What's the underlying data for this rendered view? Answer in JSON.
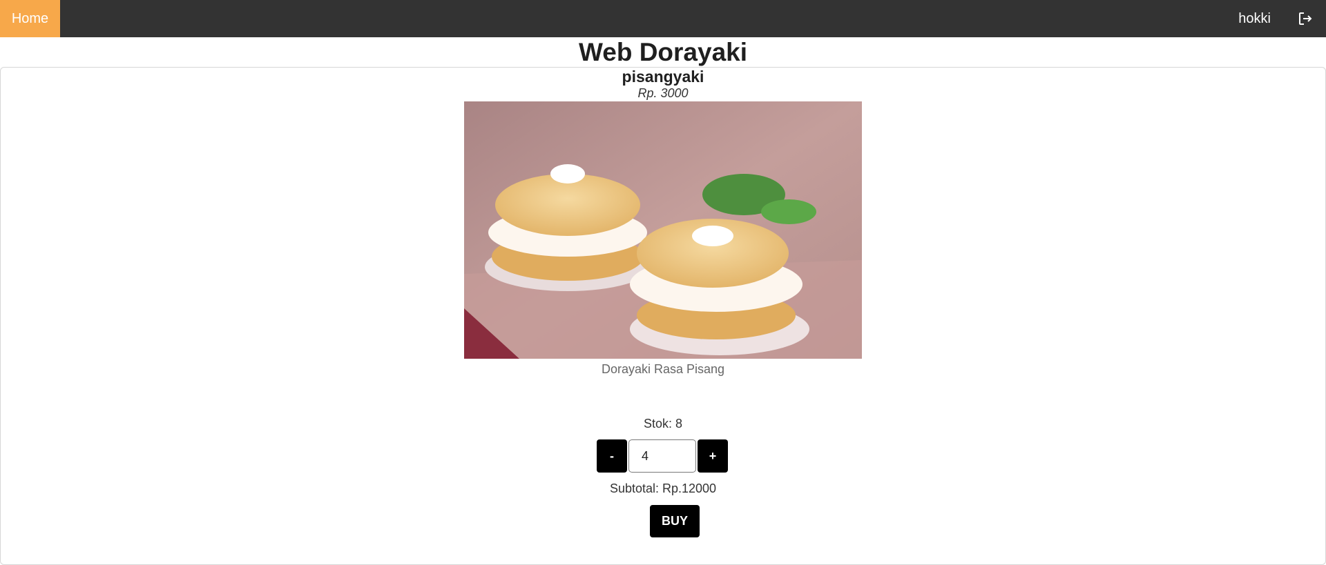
{
  "nav": {
    "home_label": "Home",
    "username": "hokki",
    "logout_icon": "logout-icon",
    "home_color": "#f7a84a",
    "bar_color": "#333333"
  },
  "page": {
    "title": "Web Dorayaki"
  },
  "product": {
    "name": "pisangyaki",
    "price": "Rp. 3000",
    "description": "Dorayaki Rasa Pisang",
    "stock_text": "Stok: 8"
  },
  "order": {
    "minus_label": "-",
    "plus_label": "+",
    "quantity": "4",
    "subtotal_text": "Subtotal: Rp.12000",
    "buy_label": "BUY"
  }
}
